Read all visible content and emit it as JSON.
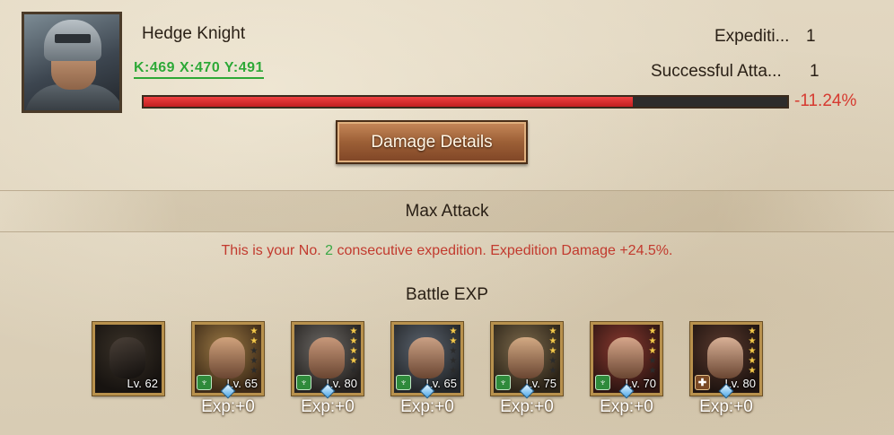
{
  "hero": {
    "name": "Hedge Knight",
    "coords": "K:469 X:470 Y:491"
  },
  "stats": {
    "expedition_label": "Expediti...",
    "expedition_value": "1",
    "success_label": "Successful Atta...",
    "success_value": "1"
  },
  "damage_bar": {
    "fill_fraction": 0.76,
    "percent_text": "-11.24%",
    "fill_color": "#d92b2b"
  },
  "buttons": {
    "damage_details": "Damage Details"
  },
  "sections": {
    "max_attack": "Max Attack",
    "streak_prefix": "This is your No. ",
    "streak_number": "2",
    "streak_suffix": " consecutive expedition. Expedition Damage +24.5%.",
    "battle_exp": "Battle EXP"
  },
  "heroes": [
    {
      "level": "Lv. 62",
      "exp": "",
      "stars_on": 0,
      "stars_off": 0,
      "class_icon": "",
      "type": "dragon"
    },
    {
      "level": "Lv. 65",
      "exp": "Exp:+0",
      "stars_on": 2,
      "stars_off": 3,
      "class_icon": "claw-icon",
      "type": "hero"
    },
    {
      "level": "Lv. 80",
      "exp": "Exp:+0",
      "stars_on": 4,
      "stars_off": 1,
      "class_icon": "claw-icon",
      "type": "hero"
    },
    {
      "level": "Lv. 65",
      "exp": "Exp:+0",
      "stars_on": 2,
      "stars_off": 3,
      "class_icon": "claw-icon",
      "type": "hero"
    },
    {
      "level": "Lv. 75",
      "exp": "Exp:+0",
      "stars_on": 3,
      "stars_off": 2,
      "class_icon": "claw-icon",
      "type": "hero"
    },
    {
      "level": "Lv. 70",
      "exp": "Exp:+0",
      "stars_on": 3,
      "stars_off": 2,
      "class_icon": "claw-icon",
      "type": "hero"
    },
    {
      "level": "Lv. 80",
      "exp": "Exp:+0",
      "stars_on": 5,
      "stars_off": 0,
      "class_icon": "shield-icon",
      "type": "hero"
    }
  ]
}
